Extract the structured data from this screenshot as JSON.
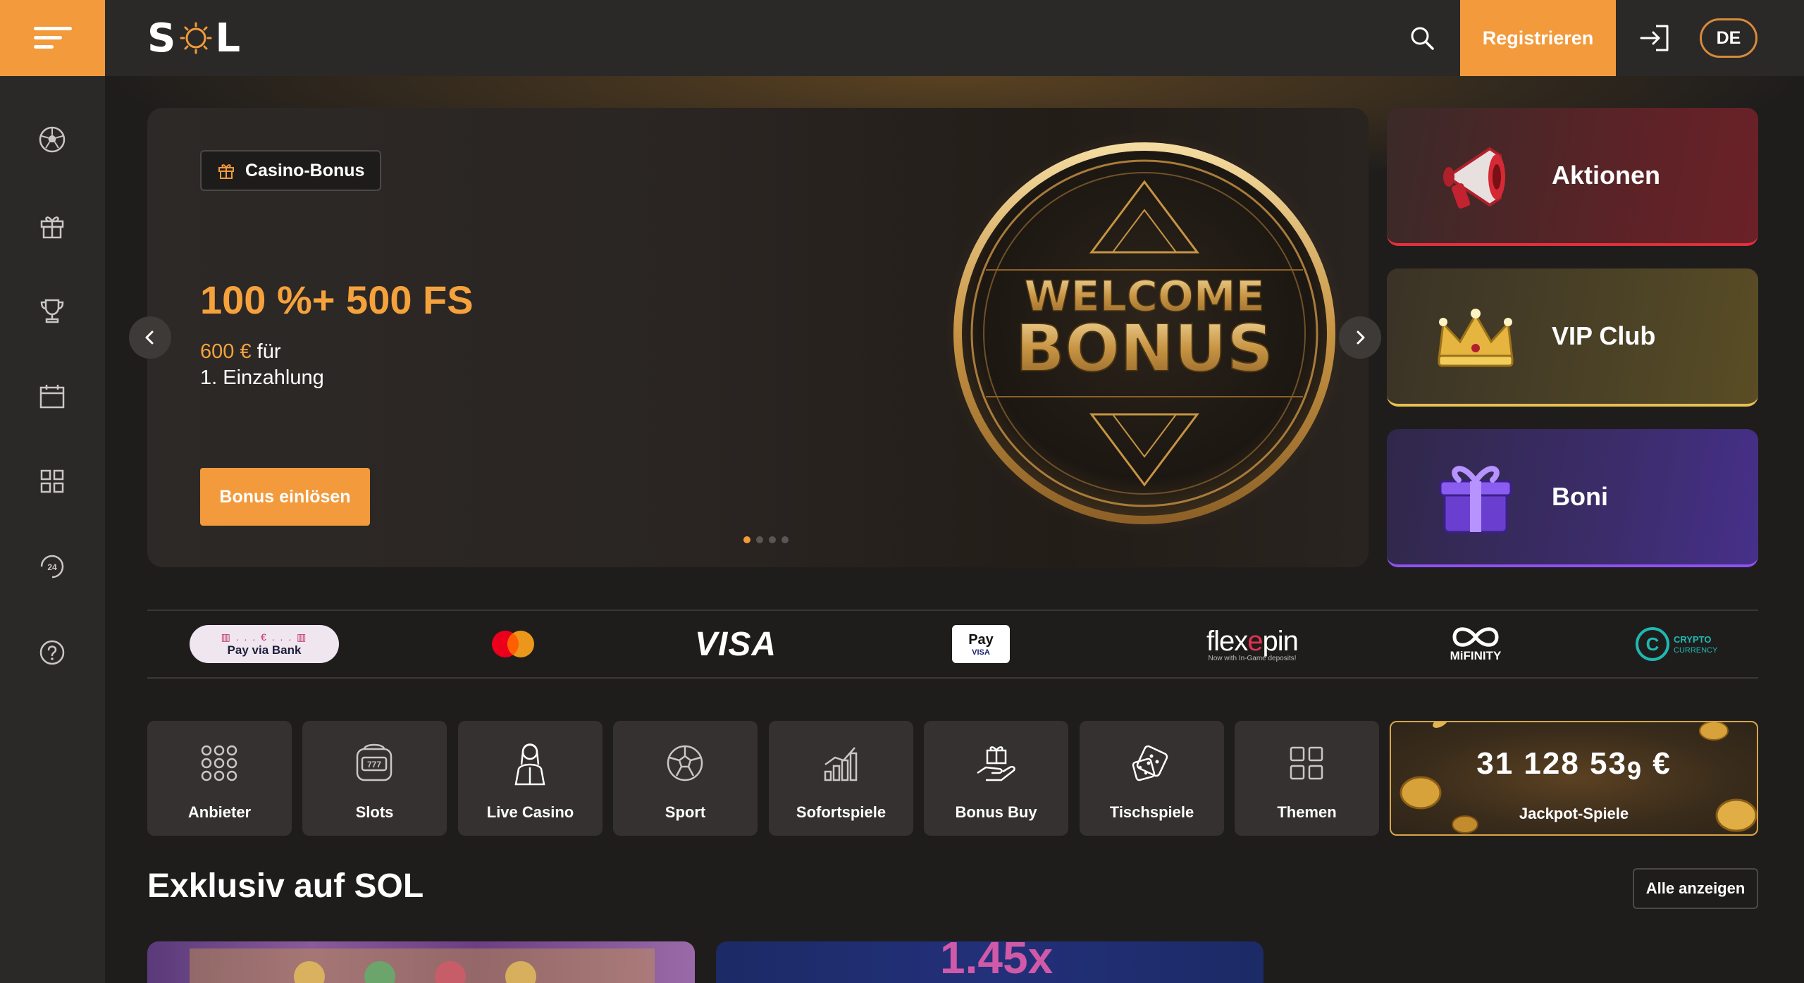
{
  "header": {
    "logo": "SOL",
    "register_label": "Registrieren",
    "language": "DE"
  },
  "sidebar": {
    "items": [
      {
        "icon": "soccer-ball-icon"
      },
      {
        "icon": "gift-icon"
      },
      {
        "icon": "trophy-icon"
      },
      {
        "icon": "calendar-icon"
      },
      {
        "icon": "grid-icon"
      },
      {
        "icon": "24h-support-icon"
      },
      {
        "icon": "help-icon"
      }
    ]
  },
  "hero": {
    "tag": "Casino-Bonus",
    "title": "100 %+ 500 FS",
    "amount": "600 €",
    "amount_suffix": " für",
    "line2": "1. Einzahlung",
    "cta": "Bonus einlösen",
    "slide_count": 4,
    "active_slide": 1,
    "coin_line1": "WELCOME",
    "coin_line2": "BONUS"
  },
  "promos": [
    {
      "label": "Aktionen",
      "icon": "megaphone-icon"
    },
    {
      "label": "VIP Club",
      "icon": "crown-icon"
    },
    {
      "label": "Boni",
      "icon": "gift-box-icon"
    }
  ],
  "payments": {
    "payvia": "Pay via Bank",
    "visa": "VISA",
    "applepay": " Pay",
    "applepay_sub": "VISA",
    "flexepin_a": "flex",
    "flexepin_e": "e",
    "flexepin_b": "pin",
    "flexepin_sub": "Now with In-Game deposits!",
    "mifinity": "MiFINITY",
    "crypto_a": "CRYPTO",
    "crypto_b": "CURRENCY",
    "colors": {
      "mastercard_red": "#eb001b",
      "mastercard_orange": "#f79e1b",
      "crypto": "#1fb8b0"
    }
  },
  "categories": [
    {
      "label": "Anbieter",
      "icon": "dots-grid-icon"
    },
    {
      "label": "Slots",
      "icon": "slot-machine-icon"
    },
    {
      "label": "Live Casino",
      "icon": "dealer-icon"
    },
    {
      "label": "Sport",
      "icon": "soccer-ball-icon"
    },
    {
      "label": "Sofortspiele",
      "icon": "bar-chart-icon"
    },
    {
      "label": "Bonus Buy",
      "icon": "hand-gift-icon"
    },
    {
      "label": "Tischspiele",
      "icon": "dice-icon"
    },
    {
      "label": "Themen",
      "icon": "tiles-icon"
    }
  ],
  "jackpot": {
    "amount_main": "31 128 53",
    "amount_small": "9",
    "currency": " €",
    "label": "Jackpot-Spiele"
  },
  "exclusive": {
    "title": "Exklusiv auf SOL",
    "show_all": "Alle anzeigen",
    "game2_text": "1.45x"
  },
  "colors": {
    "accent": "#f29a3c",
    "background": "#1f1d1c",
    "panel": "#2b2928"
  }
}
